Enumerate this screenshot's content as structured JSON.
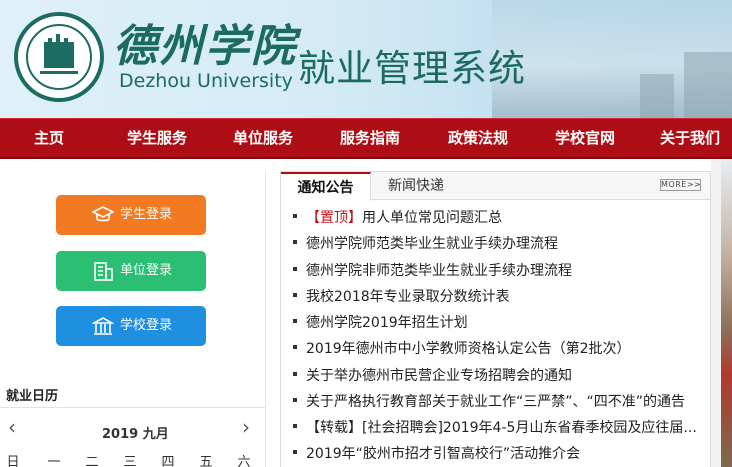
{
  "brand": {
    "name_cn": "德州学院",
    "name_en": "Dezhou University",
    "system": "就业管理系统"
  },
  "nav": {
    "items": [
      {
        "label": "主页"
      },
      {
        "label": "学生服务"
      },
      {
        "label": "单位服务"
      },
      {
        "label": "服务指南"
      },
      {
        "label": "政策法规"
      },
      {
        "label": "学校官网"
      },
      {
        "label": "关于我们"
      }
    ]
  },
  "login": {
    "student": {
      "label": "学生登录",
      "icon": "graduation-cap-icon",
      "color": "#f27a23"
    },
    "company": {
      "label": "单位登录",
      "icon": "building-icon",
      "color": "#2bbf73"
    },
    "school": {
      "label": "学校登录",
      "icon": "school-icon",
      "color": "#1f8fe0"
    }
  },
  "calendar": {
    "title": "就业日历",
    "month_label": "2019 九月",
    "prev": "‹",
    "next": "›",
    "weekdays": [
      "日",
      "一",
      "二",
      "三",
      "四",
      "五",
      "六"
    ]
  },
  "notices": {
    "tabs": [
      {
        "label": "通知公告",
        "active": true
      },
      {
        "label": "新闻快递",
        "active": false
      }
    ],
    "more_label": "MORE>>",
    "items": [
      {
        "tag": "【置顶】",
        "text": "用人单位常见问题汇总"
      },
      {
        "tag": "",
        "text": "德州学院师范类毕业生就业手续办理流程"
      },
      {
        "tag": "",
        "text": "德州学院非师范类毕业生就业手续办理流程"
      },
      {
        "tag": "",
        "text": "我校2018年专业录取分数统计表"
      },
      {
        "tag": "",
        "text": "德州学院2019年招生计划"
      },
      {
        "tag": "",
        "text": "2019年德州市中小学教师资格认定公告（第2批次）"
      },
      {
        "tag": "",
        "text": "关于举办德州市民营企业专场招聘会的通知"
      },
      {
        "tag": "",
        "text": "关于严格执行教育部关于就业工作“三严禁”、“四不准”的通告"
      },
      {
        "tag": "",
        "text": "【转载】[社会招聘会]2019年4-5月山东省春季校园及应往届..."
      },
      {
        "tag": "",
        "text": "2019年“胶州市招才引智高校行”活动推介会"
      }
    ]
  },
  "colors": {
    "brand_green": "#1b6b5f",
    "nav_red": "#ad0e15",
    "tag_red": "#c4141b"
  }
}
